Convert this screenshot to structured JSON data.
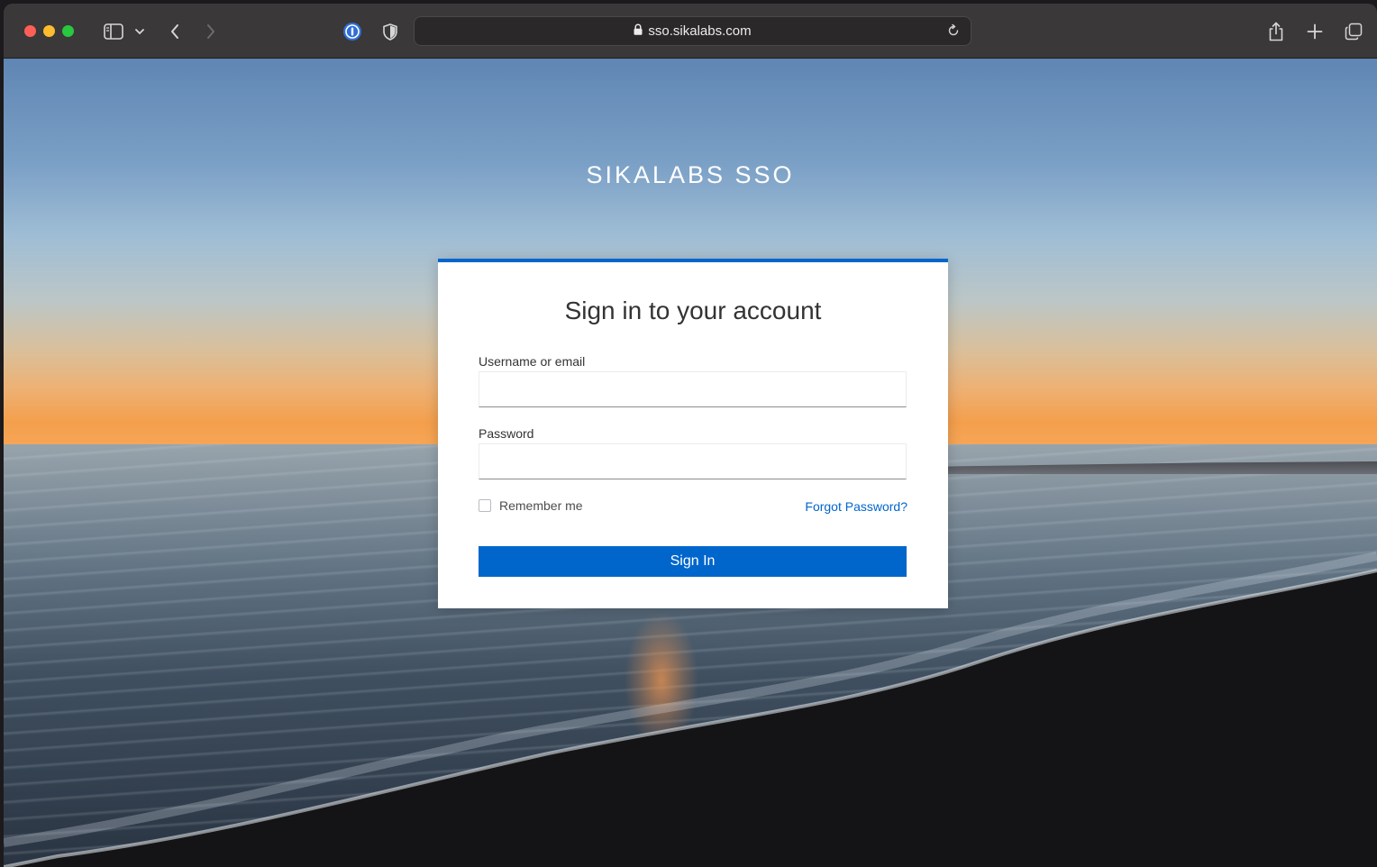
{
  "browser": {
    "url": "sso.sikalabs.com",
    "icons": {
      "sidebar": "sidebar-icon",
      "back": "chevron-left-icon",
      "forward": "chevron-right-icon",
      "password_manager": "password-manager-icon",
      "privacy": "shield-icon",
      "lock": "lock-icon",
      "reload": "reload-icon",
      "share": "share-icon",
      "new_tab": "plus-icon",
      "tab_overview": "tab-overview-icon"
    }
  },
  "page": {
    "brand": "SIKALABS SSO",
    "title": "Sign in to your account",
    "username_label": "Username or email",
    "username_value": "",
    "password_label": "Password",
    "password_value": "",
    "remember_label": "Remember me",
    "remember_checked": false,
    "forgot_label": "Forgot Password?",
    "submit_label": "Sign In"
  },
  "colors": {
    "accent": "#0066cc"
  }
}
